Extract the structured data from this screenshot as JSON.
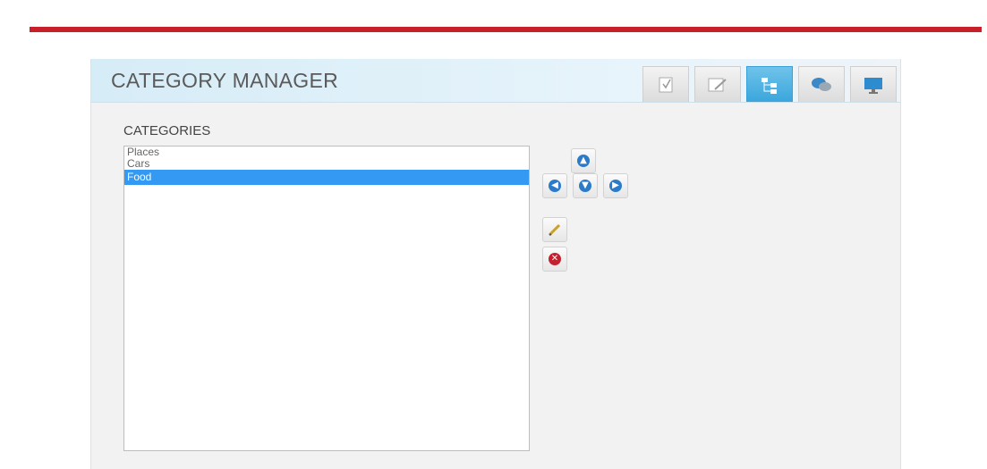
{
  "panel": {
    "title": "CATEGORY MANAGER",
    "tabs": [
      {
        "icon": "checklist-icon",
        "active": false
      },
      {
        "icon": "edit-document-icon",
        "active": false
      },
      {
        "icon": "hierarchy-icon",
        "active": true
      },
      {
        "icon": "chat-bubbles-icon",
        "active": false
      },
      {
        "icon": "monitor-icon",
        "active": false
      }
    ]
  },
  "categories": {
    "label": "CATEGORIES",
    "items": [
      "Places",
      "Cars",
      "Food"
    ],
    "selected_index": 2
  },
  "controls": {
    "move_up": "up-arrow-icon",
    "move_left": "left-arrow-icon",
    "move_down": "down-arrow-icon",
    "move_right": "right-arrow-icon",
    "edit": "pencil-icon",
    "delete": "delete-x-icon"
  },
  "colors": {
    "accent_red": "#c8202a",
    "selection_blue": "#3399f3",
    "active_tab": "#3aa6dc"
  }
}
